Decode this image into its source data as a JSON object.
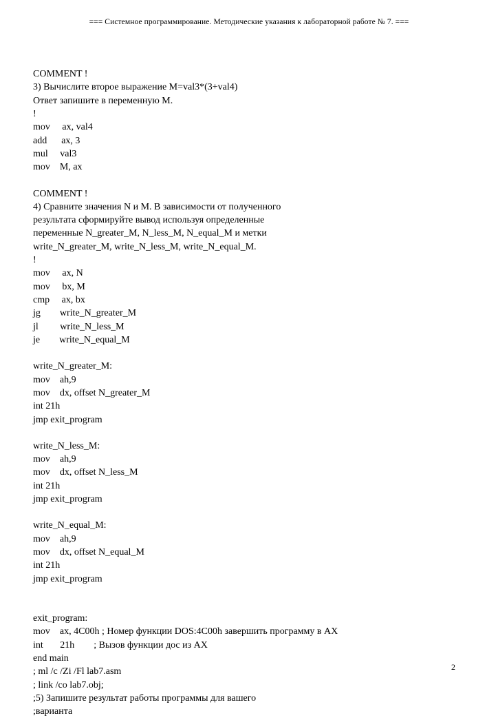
{
  "header": "=== Системное программирование. Методические указания к лабораторной работе № 7. ===",
  "lines": {
    "b1l1": "COMMENT !",
    "b1l2": "3) Вычислите второе выражение M=val3*(3+val4)",
    "b1l3": "Ответ запишите в переменную M.",
    "b1l4": "!",
    "b1l5": "mov     ax, val4",
    "b1l6": "add      ax, 3",
    "b1l7": "mul     val3",
    "b1l8": "mov    M, ax",
    "b2l1": "COMMENT !",
    "b2l2": "4) Сравните значения N и M. В зависимости от полученного",
    "b2l3": "результата сформируйте вывод используя определенные",
    "b2l4": "переменные N_greater_M, N_less_M, N_equal_M и метки",
    "b2l5": "write_N_greater_M, write_N_less_M, write_N_equal_M.",
    "b2l6": "!",
    "b2l7": "mov     ax, N",
    "b2l8": "mov     bx, M",
    "b2l9": "cmp     ax, bx",
    "b2l10": "jg        write_N_greater_M",
    "b2l11": "jl         write_N_less_M",
    "b2l12": "je        write_N_equal_M",
    "b3l1": "write_N_greater_M:",
    "b3l2": "mov    ah,9",
    "b3l3": "mov    dx, offset N_greater_M",
    "b3l4": "int 21h",
    "b3l5": "jmp exit_program",
    "b4l1": "write_N_less_M:",
    "b4l2": "mov    ah,9",
    "b4l3": "mov    dx, offset N_less_M",
    "b4l4": "int 21h",
    "b4l5": "jmp exit_program",
    "b5l1": "write_N_equal_M:",
    "b5l2": "mov    ah,9",
    "b5l3": "mov    dx, offset N_equal_M",
    "b5l4": "int 21h",
    "b5l5": "jmp exit_program",
    "b6l1": "exit_program:",
    "b6l2": "mov    ax, 4C00h ; Номер функции DOS:4C00h завершить программу в AX",
    "b6l3": "int       21h        ; Вызов функции дос из AX",
    "b6l4": "end main",
    "b6l5": "; ml /c /Zi /Fl lab7.asm",
    "b6l6": "; link /co lab7.obj;",
    "b6l7": ";5) Запишите результат работы программы для вашего",
    "b6l8": ";варианта"
  },
  "page_number": "2"
}
